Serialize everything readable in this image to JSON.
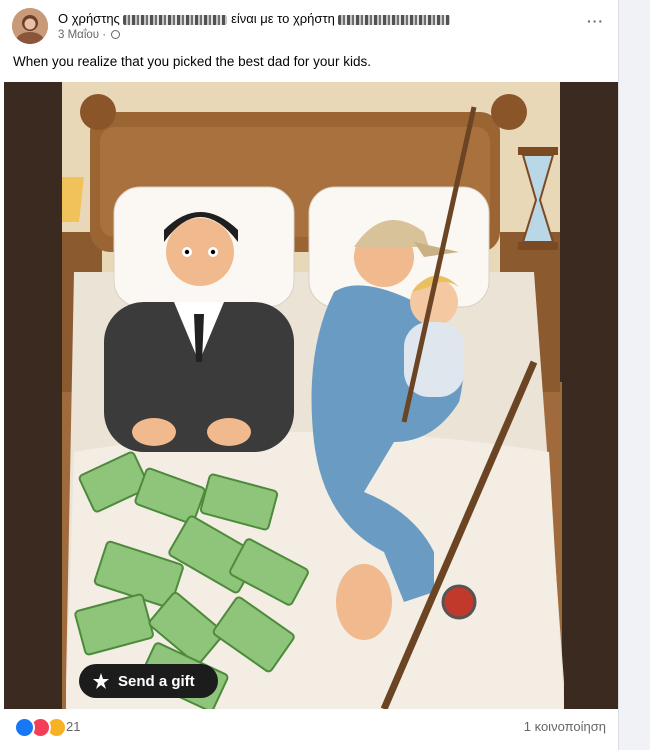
{
  "post": {
    "header_prefix": "Ο χρήστης",
    "header_middle": "είναι με το χρήστη",
    "date": "3 Μαΐου ·",
    "more_label": "···",
    "caption": "When you realize that you picked the best dad for your kids."
  },
  "media": {
    "gift_button_label": "Send a gift",
    "gift_icon": "gift-star-icon"
  },
  "footer": {
    "reaction_count": "21",
    "reactions": [
      "like",
      "love",
      "wow"
    ],
    "shares": "1 κοινοποίηση"
  },
  "colors": {
    "accent": "#1877f2",
    "love": "#f33e58",
    "wow": "#f7b125",
    "muted_text": "#65676b"
  }
}
